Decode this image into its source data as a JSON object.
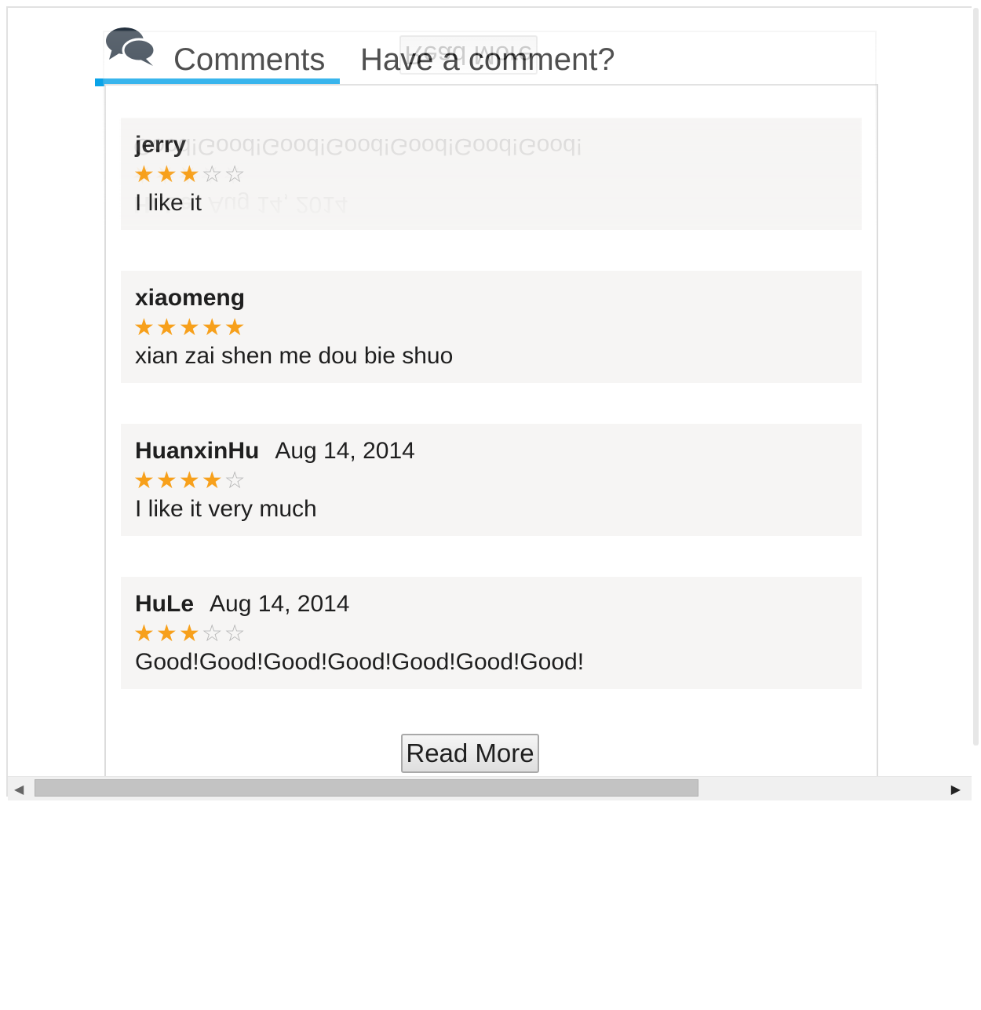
{
  "tabs": {
    "comments_label": "Comments",
    "have_comment_label": "Have a comment?",
    "accent_color": "#0aa3e8",
    "icon": "speech-bubbles-icon"
  },
  "comments": [
    {
      "name": "jerry",
      "date": "",
      "rating": 3,
      "max_rating": 5,
      "text": "I like it"
    },
    {
      "name": "xiaomeng",
      "date": "",
      "rating": 5,
      "max_rating": 5,
      "text": "xian zai shen me dou bie shuo"
    },
    {
      "name": "HuanxinHu",
      "date": "Aug 14, 2014",
      "rating": 4,
      "max_rating": 5,
      "text": "I like it very much"
    },
    {
      "name": "HuLe",
      "date": "Aug 14, 2014",
      "rating": 3,
      "max_rating": 5,
      "text": "Good!Good!Good!Good!Good!Good!Good!"
    }
  ],
  "read_more_label": "Read More",
  "colors": {
    "star_on": "#f7a01b",
    "star_off": "#b5b5b5",
    "comment_bg": "#f6f5f4"
  }
}
